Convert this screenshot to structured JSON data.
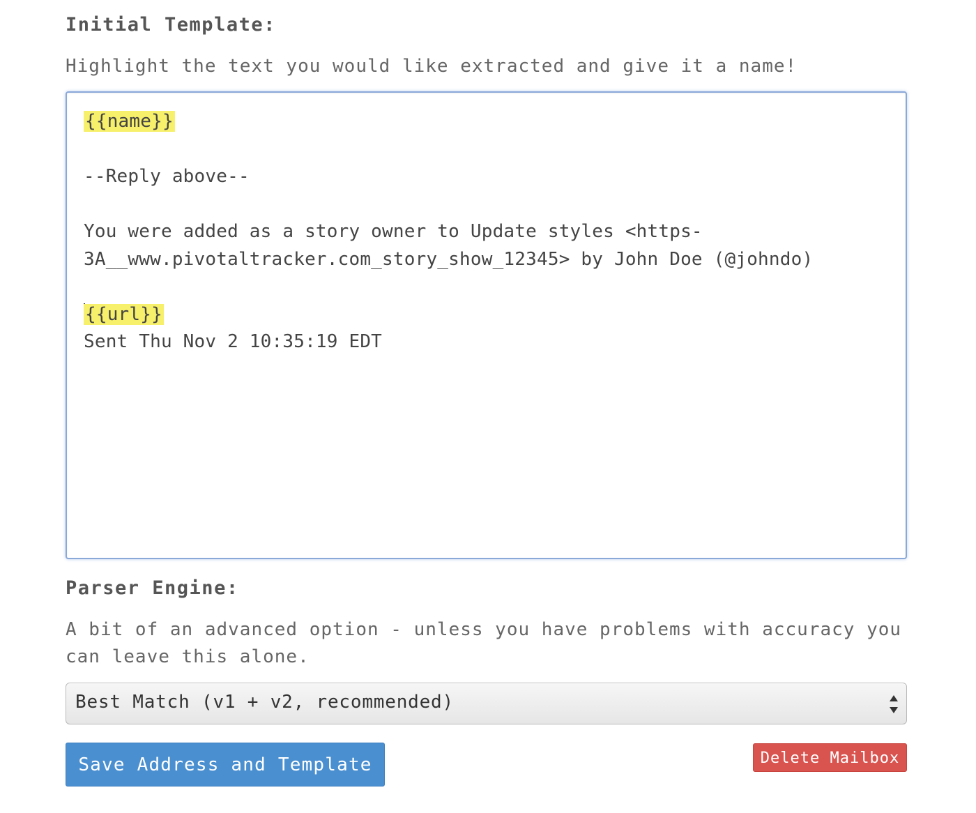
{
  "initial_template": {
    "heading": "Initial Template:",
    "help": "Highlight the text you would like extracted and give it a name!",
    "editor": {
      "line1_highlight": "{{name}}",
      "line2": "",
      "line3": "--Reply above--",
      "line4": "",
      "line5": "You were added as a story owner to Update styles <https-",
      "line6": "3A__www.pivotaltracker.com_story_show_12345> by John Doe (@johndo)",
      "line7": "",
      "line8_highlight": "{{url}}",
      "line9": "Sent Thu Nov 2 10:35:19 EDT",
      "highlight_color": "#f7f06a"
    }
  },
  "parser_engine": {
    "heading": "Parser Engine:",
    "help": "A bit of an advanced option - unless you have problems with accuracy you can leave this alone.",
    "selected": "Best Match (v1 + v2, recommended)"
  },
  "actions": {
    "save_label": "Save Address and Template",
    "delete_label": "Delete Mailbox",
    "save_color": "#4a8fd0",
    "delete_color": "#d9534f"
  }
}
